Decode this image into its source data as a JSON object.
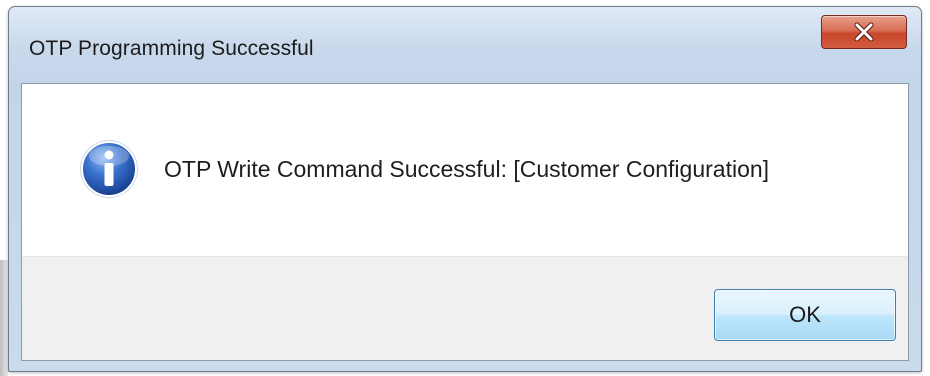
{
  "dialog": {
    "title": "OTP Programming Successful",
    "message": "OTP Write Command Successful: [Customer Configuration]",
    "icon": "information-icon",
    "close_icon": "close-icon"
  },
  "buttons": {
    "ok_label": "OK"
  },
  "colors": {
    "title_bar": "#c9d9ec",
    "close_button": "#c7462b",
    "info_icon": "#2f61b5",
    "ok_button": "#bee6fd",
    "footer": "#f0f0f0"
  }
}
